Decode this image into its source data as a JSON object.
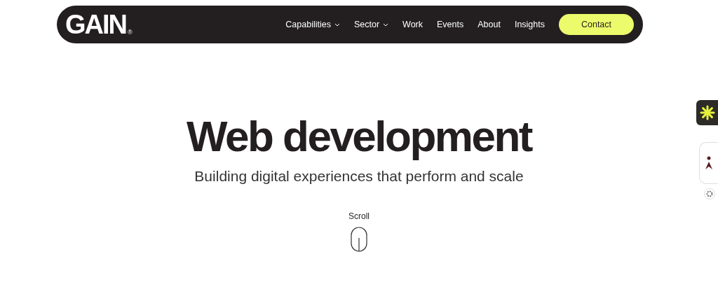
{
  "header": {
    "logo": "GAIN",
    "logo_mark": "®",
    "nav": [
      {
        "label": "Capabilities",
        "kind": "dropdown"
      },
      {
        "label": "Sector",
        "kind": "dropdown"
      },
      {
        "label": "Work",
        "kind": "link"
      },
      {
        "label": "Events",
        "kind": "link"
      },
      {
        "label": "About",
        "kind": "link"
      },
      {
        "label": "Insights",
        "kind": "link"
      }
    ],
    "cta": "Contact"
  },
  "hero": {
    "title": "Web development",
    "subtitle": "Building digital experiences that perform and scale",
    "scroll_label": "Scroll"
  }
}
